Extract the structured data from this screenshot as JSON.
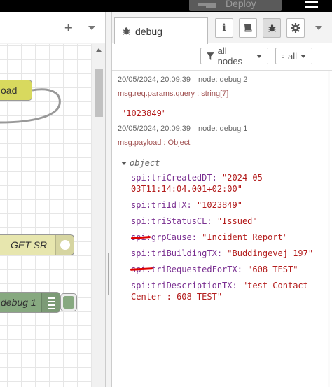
{
  "header": {
    "deploy_label": "Deploy"
  },
  "workspace": {
    "nodes": {
      "payload_label": "oad",
      "getsr_label": "GET SR",
      "debug_label": "debug 1"
    }
  },
  "sidebar": {
    "active_tab_label": "debug",
    "filter_nodes_label": "all nodes",
    "clear_label": "all"
  },
  "messages": [
    {
      "timestamp": "20/05/2024, 20:09:39",
      "node": "node: debug 2",
      "topic": "msg.req.params.query : string[7]",
      "value": "\"1023849\""
    },
    {
      "timestamp": "20/05/2024, 20:09:39",
      "node": "node: debug 1",
      "topic": "msg.payload : Object",
      "object_label": "object",
      "properties": [
        {
          "key": "spi:triCreatedDT",
          "value": "\"2024-05-03T11:14:04.001+02:00\""
        },
        {
          "key": "spi:triIdTX",
          "value": "\"1023849\""
        },
        {
          "key": "spi:triStatusCL",
          "value": "\"Issued\""
        },
        {
          "key": "spi:grpCause",
          "value": "\"Incident Report\""
        },
        {
          "key": "spi:triBuildingTX",
          "value": "\"Buddingevej 197\""
        },
        {
          "key": "spi:triRequestedForTX",
          "value": "\"608 TEST\""
        },
        {
          "key": "spi:triDescriptionTX",
          "value": "\"test Contact Center : 608 TEST\""
        }
      ]
    }
  ],
  "colors": {
    "header_bg": "#000000",
    "payload_node": "#d8d95e",
    "http_node": "#e7e6ae",
    "debug_node": "#87a980",
    "property_key": "#792e90",
    "property_value": "#b31b1b",
    "annotation": "#e00000"
  },
  "icons": {
    "debug_tab": "bug-icon",
    "info": "info-icon",
    "help": "book-icon",
    "debugger": "bug-icon",
    "config": "gear-icon",
    "filter": "filter-icon",
    "clear": "trash-icon"
  }
}
